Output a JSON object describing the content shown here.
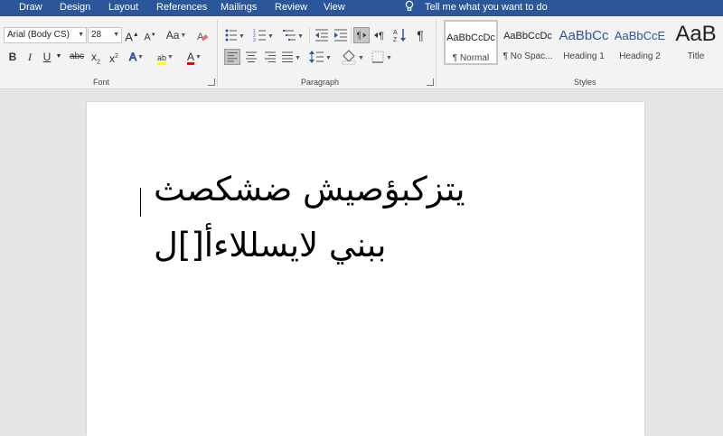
{
  "menu": {
    "tabs": [
      "Draw",
      "Design",
      "Layout",
      "References",
      "Mailings",
      "Review",
      "View"
    ],
    "tell_me": "Tell me what you want to do"
  },
  "ribbon": {
    "font": {
      "name": "Arial (Body CS)",
      "size": "28",
      "grow": "A",
      "shrink": "A",
      "change_case": "Aa",
      "bold": "B",
      "italic": "I",
      "underline": "U",
      "strikethrough": "abc",
      "subscript": "x",
      "superscript": "x",
      "text_effects": "A",
      "highlight": "ab",
      "font_color": "A",
      "label": "Font"
    },
    "paragraph": {
      "label": "Paragraph"
    },
    "styles": {
      "label": "Styles",
      "items": [
        {
          "sample": "AaBbCcDc",
          "name": "¶ Normal",
          "selected": true
        },
        {
          "sample": "AaBbCcDc",
          "name": "¶ No Spac...",
          "selected": false
        },
        {
          "sample": "AaBbCc",
          "name": "Heading 1",
          "selected": false
        },
        {
          "sample": "AaBbCcE",
          "name": "Heading 2",
          "selected": false
        },
        {
          "sample": "AaB",
          "name": "Title",
          "selected": false
        }
      ]
    }
  },
  "document": {
    "lines": [
      "يتزكبؤصيش ضشكصث",
      "ببني لايسللاءأ[]ل"
    ]
  },
  "colors": {
    "tab_bar": "#2b579a",
    "highlight": "#ffff00",
    "font_color": "#ff0000",
    "heading": "#2f5597"
  }
}
